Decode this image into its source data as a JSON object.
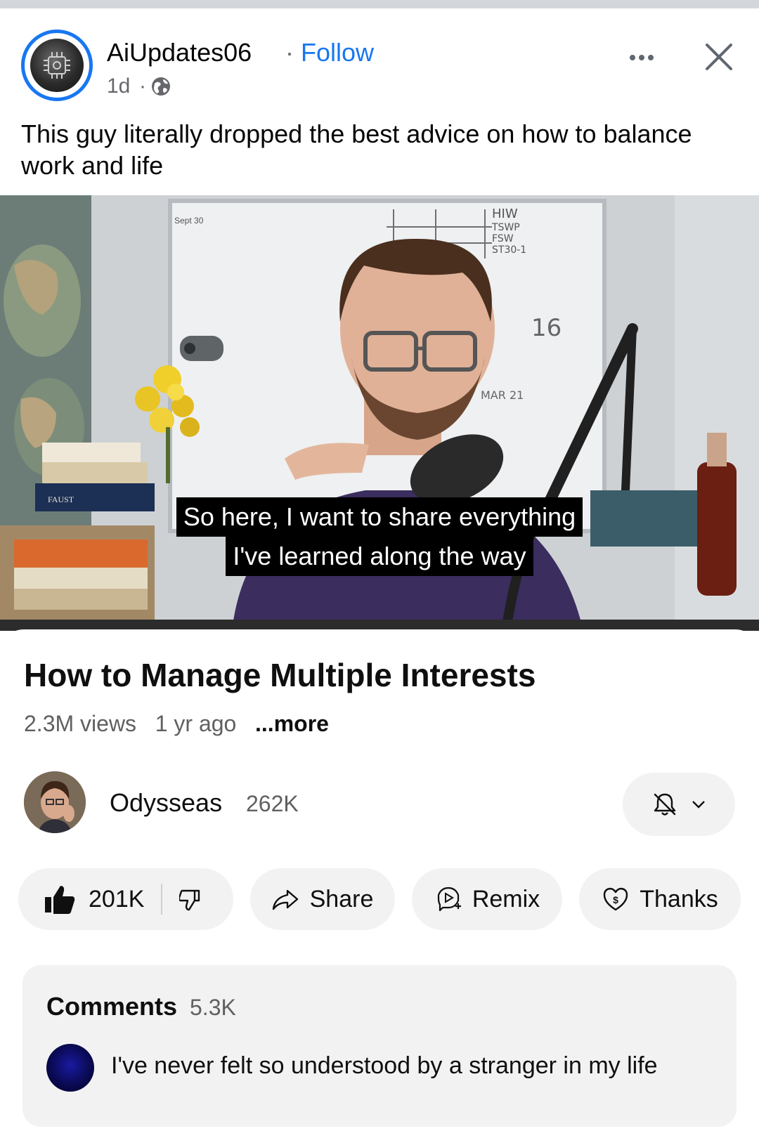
{
  "post": {
    "author": "AiUpdates06",
    "separator": "·",
    "follow_label": "Follow",
    "time": "1d",
    "time_separator": "·",
    "caption": "This guy literally dropped the best advice on how to balance work and life"
  },
  "video": {
    "subtitle_line1": "So here, I want to share everything",
    "subtitle_line2": "I've learned along the way",
    "whiteboard": {
      "corner": "Sept 30",
      "notes": [
        "HIW",
        "TSWP",
        "FSW",
        "ST30-1"
      ],
      "number": "16",
      "date": "MAR 21"
    },
    "book_spine": "FAUST"
  },
  "youtube": {
    "title": "How to Manage Multiple Interests",
    "views": "2.3M views",
    "age": "1 yr ago",
    "more_label": "...more",
    "channel": {
      "name": "Odysseas",
      "subscribers": "262K"
    },
    "actions": {
      "likes": "201K",
      "share_label": "Share",
      "remix_label": "Remix",
      "thanks_label": "Thanks"
    },
    "comments": {
      "title": "Comments",
      "count": "5.3K",
      "top_comment": "I've never felt so understood by a stranger in my life"
    }
  },
  "colors": {
    "facebook_blue": "#1877f2",
    "pill_bg": "#f2f2f2",
    "secondary_text": "#606060"
  },
  "icons": [
    "globe-icon",
    "more-icon",
    "close-icon",
    "bell-off-icon",
    "chevron-down-icon",
    "thumbs-up-icon",
    "thumbs-down-icon",
    "share-icon",
    "remix-icon",
    "thanks-icon"
  ]
}
